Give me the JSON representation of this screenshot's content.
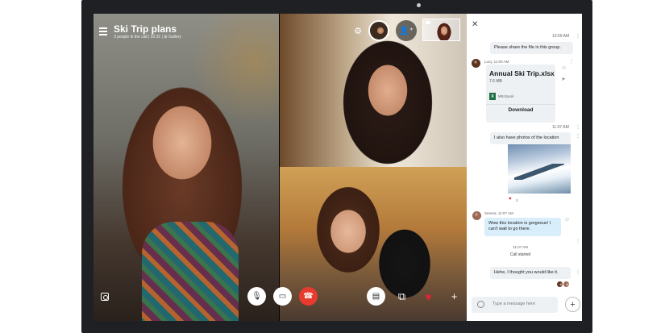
{
  "call": {
    "title": "Ski Trip plans",
    "subtitle": "3 people in the call | 02:31 | ⊞ Gallery"
  },
  "controls": {
    "gear_icon": "⚙",
    "add_person_icon": "👤⁺",
    "mic_icon": "🎙",
    "video_icon": "▭",
    "hangup_icon": "☎",
    "chat_icon": "▤",
    "screen_share_icon": "⧉",
    "heart_icon": "♥",
    "plus_icon": "+"
  },
  "chat": {
    "close_icon": "✕",
    "messages": [
      {
        "time": "10:59 AM",
        "text": "Please share the file in this group."
      },
      {
        "sender": "Lucy, 11:00 AM"
      },
      {
        "time": "11:07 AM",
        "text": "I also have photos of the location"
      },
      {
        "sender": "Serena, 11:07 AM",
        "text": "Wow this location is gorgeous! I can't wait to go there."
      },
      {
        "time": "11:07 AM",
        "text": "Hehe, I thought you would like it."
      }
    ],
    "file": {
      "name": "Annual Ski Trip.xlsx",
      "size": "7.6 MB",
      "type": "MS Excel",
      "download_label": "Download"
    },
    "reaction_count": "1",
    "call_started_time": "11:07 AM",
    "call_started_label": "Call started",
    "compose_placeholder": "Type a message here"
  },
  "colors": {
    "accent_red": "#e63b2e",
    "heart": "#e0243a",
    "bubble_blue": "#d9eefb"
  }
}
